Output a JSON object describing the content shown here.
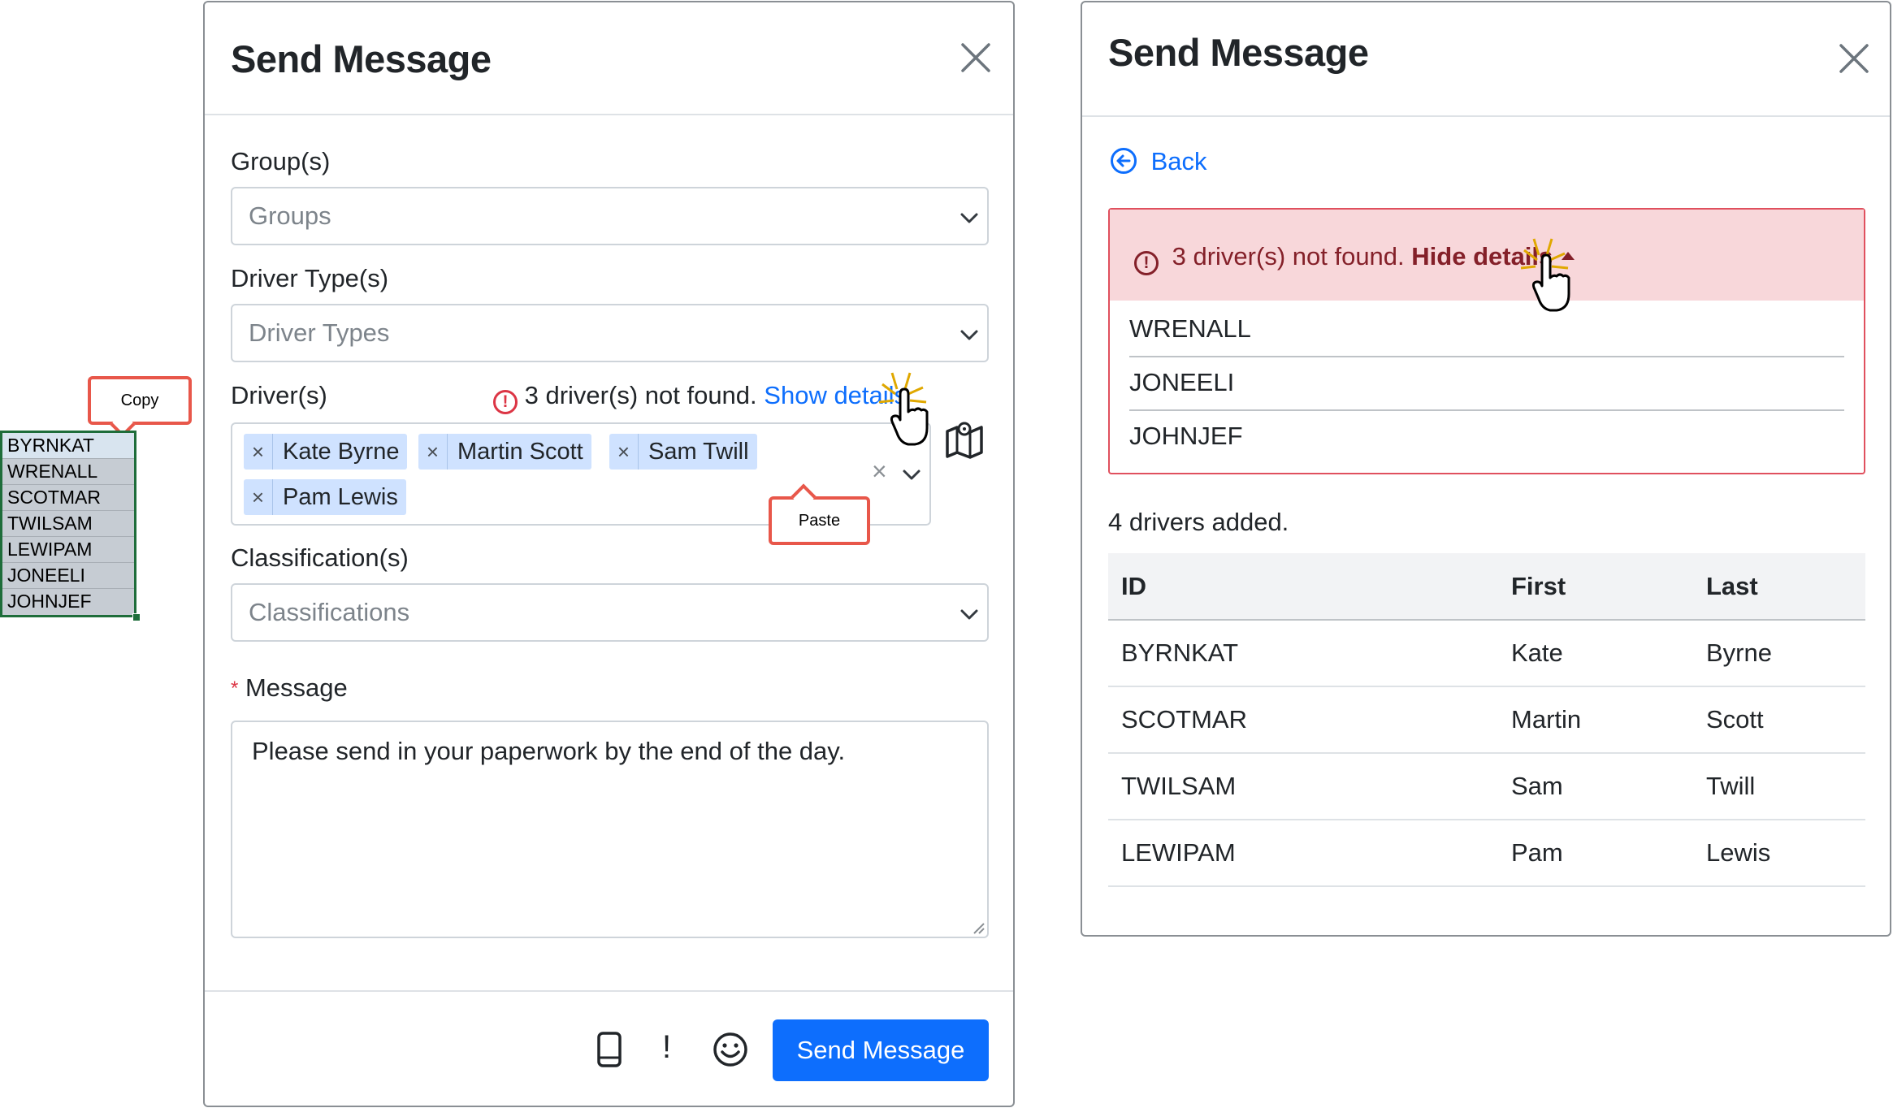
{
  "spreadsheet": {
    "cells": [
      "BYRNKAT",
      "WRENALL",
      "SCOTMAR",
      "TWILSAM",
      "LEWIPAM",
      "JONEELI",
      "JOHNJEF"
    ]
  },
  "callouts": {
    "copy": "Copy",
    "paste": "Paste"
  },
  "left_modal": {
    "title": "Send Message",
    "groups": {
      "label": "Group(s)",
      "placeholder": "Groups"
    },
    "driver_types": {
      "label": "Driver Type(s)",
      "placeholder": "Driver Types"
    },
    "drivers": {
      "label": "Driver(s)",
      "not_found_text": "3 driver(s) not found.",
      "show_details_link": "Show details",
      "tags": [
        "Kate Byrne",
        "Martin Scott",
        "Sam Twill",
        "Pam Lewis"
      ],
      "tag_remove": "×",
      "clear": "×"
    },
    "classifications": {
      "label": "Classification(s)",
      "placeholder": "Classifications"
    },
    "message": {
      "required_mark": "*",
      "label": "Message",
      "value": "Please send in your paperwork by the end of the day."
    },
    "footer": {
      "exclamation": "!",
      "send_button": "Send Message"
    }
  },
  "right_modal": {
    "title": "Send Message",
    "back_link": "Back",
    "alert": {
      "text": "3 driver(s) not found.",
      "hide_details_link": "Hide details",
      "not_found_ids": [
        "WRENALL",
        "JONEELI",
        "JOHNJEF"
      ]
    },
    "added_text": "4 drivers added.",
    "table": {
      "headers": [
        "ID",
        "First",
        "Last"
      ],
      "rows": [
        [
          "BYRNKAT",
          "Kate",
          "Byrne"
        ],
        [
          "SCOTMAR",
          "Martin",
          "Scott"
        ],
        [
          "TWILSAM",
          "Sam",
          "Twill"
        ],
        [
          "LEWIPAM",
          "Pam",
          "Lewis"
        ]
      ]
    }
  },
  "colors": {
    "primary": "#0d6efd",
    "danger": "#dc3545",
    "alert_bg": "#f8d7da",
    "alert_text": "#842029",
    "tag_bg": "#cfe2ff",
    "callout_border": "#e8574a",
    "sheet_border": "#1e6d3a"
  },
  "icons": [
    "close-icon",
    "chevron-down-icon",
    "error-circle-icon",
    "map-icon",
    "mobile-phone-icon",
    "smiley-icon",
    "back-arrow-circle-icon",
    "caret-up-icon",
    "hand-pointer-icon"
  ]
}
